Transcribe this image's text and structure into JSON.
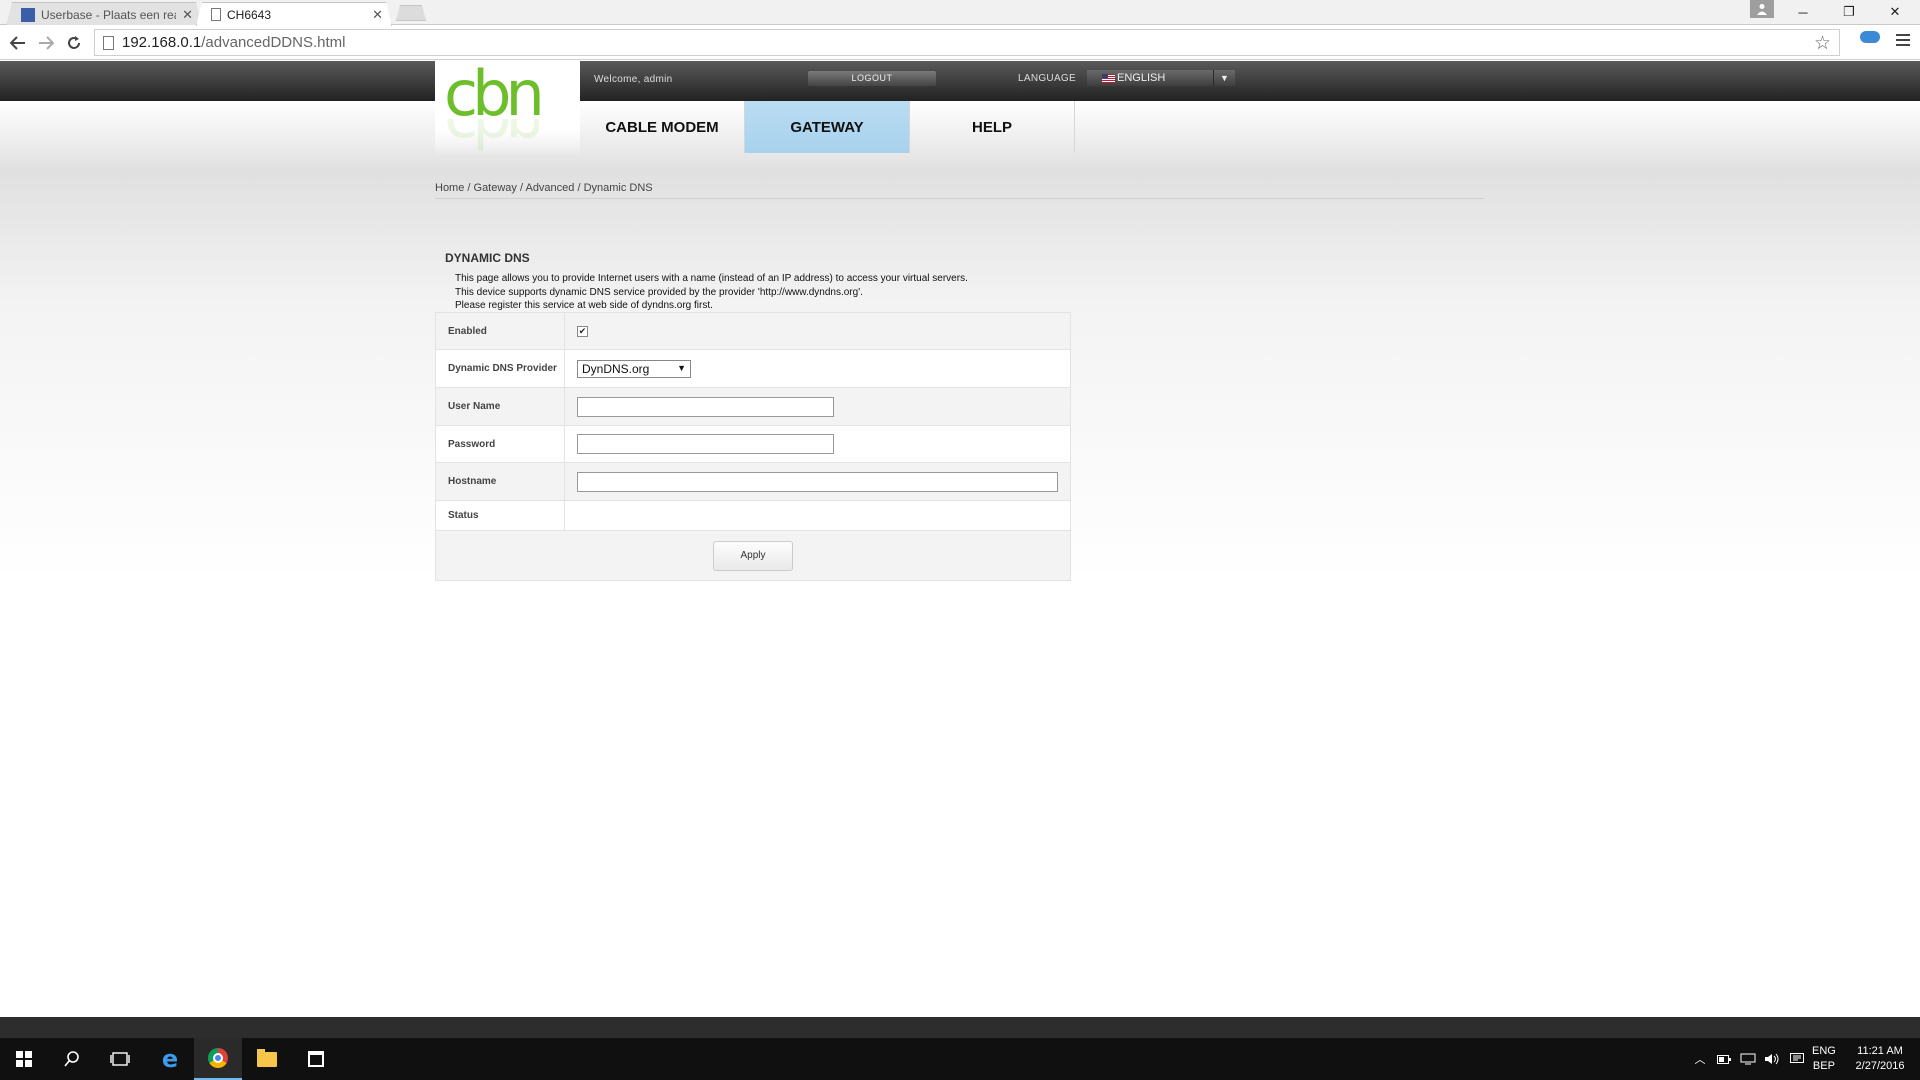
{
  "browser": {
    "tabs": [
      {
        "title": "Userbase - Plaats een reac",
        "close": "✕"
      },
      {
        "title": "CH6643",
        "close": "✕"
      }
    ],
    "url_host": "192.168.0.1",
    "url_path": "/advancedDDNS.html",
    "window_buttons": {
      "minimize": "─",
      "restore": "❐",
      "close": "✕"
    }
  },
  "header": {
    "welcome": "Welcome, admin",
    "logout": "LOGOUT",
    "language_label": "LANGUAGE",
    "language_value": "ENGLISH",
    "logo_text": "cbn"
  },
  "nav": {
    "items": [
      "CABLE MODEM",
      "GATEWAY",
      "HELP"
    ],
    "active": "GATEWAY"
  },
  "breadcrumb": "Home / Gateway / Advanced / Dynamic DNS",
  "section": {
    "title": "DYNAMIC DNS",
    "description": [
      "This page allows you to provide Internet users with a name (instead of an IP address) to access your virtual servers.",
      "This device supports dynamic DNS service provided by the provider 'http://www.dyndns.org'.",
      "Please register this service at web side of dyndns.org first."
    ]
  },
  "form": {
    "enabled_label": "Enabled",
    "enabled_checked": true,
    "provider_label": "Dynamic DNS Provider",
    "provider_value": "DynDNS.org",
    "username_label": "User Name",
    "username_value": "",
    "password_label": "Password",
    "password_value": "",
    "hostname_label": "Hostname",
    "hostname_value": "",
    "status_label": "Status",
    "status_value": "",
    "apply_label": "Apply"
  },
  "taskbar": {
    "language": "ENG",
    "layout": "BEP",
    "time": "11:21 AM",
    "date": "2/27/2016"
  }
}
